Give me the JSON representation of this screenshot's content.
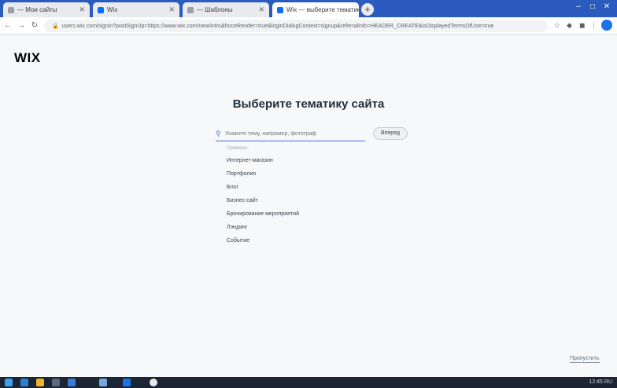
{
  "browser": {
    "tabs": [
      {
        "label": "— Мои сайты",
        "color": "#5f6368",
        "active": false
      },
      {
        "label": "Wix",
        "color": "#0c6efc",
        "active": false
      },
      {
        "label": "— Шаблоны",
        "color": "#5f6368",
        "active": false
      },
      {
        "label": "Wix — выберите тематику",
        "color": "#0c6efc",
        "active": true
      }
    ],
    "new_tab_label": "+",
    "window_controls": [
      "–",
      "□",
      "✕"
    ],
    "nav_icons": [
      "←",
      "→",
      "↻",
      "⌂"
    ],
    "url": "users.wix.com/signin?postSignUp=https://www.wix.com/new/intro&forceRender=true&loginDialogContext=signup&referralInfo=HEADER_CREATE&isDisplayedTermsOfUse=true"
  },
  "page": {
    "logo": "WIX",
    "title": "Выберите тематику сайта",
    "search": {
      "placeholder": "Укажите тему, например, фотограф",
      "button_label": "Вперед"
    },
    "suggestions": {
      "label": "Примеры:",
      "items": [
        "Интернет-магазин",
        "Портфолио",
        "Блог",
        "Бизнес-сайт",
        "Бронирование мероприятий",
        "Лэндинг",
        "Событие"
      ]
    },
    "skip_label": "Пропустить"
  },
  "taskbar": {
    "tray_text": "12:45 RU"
  },
  "colors": {
    "accent": "#3b6df0",
    "page_bg": "#f7f8fa",
    "browser_frame": "#2b5bbf"
  }
}
